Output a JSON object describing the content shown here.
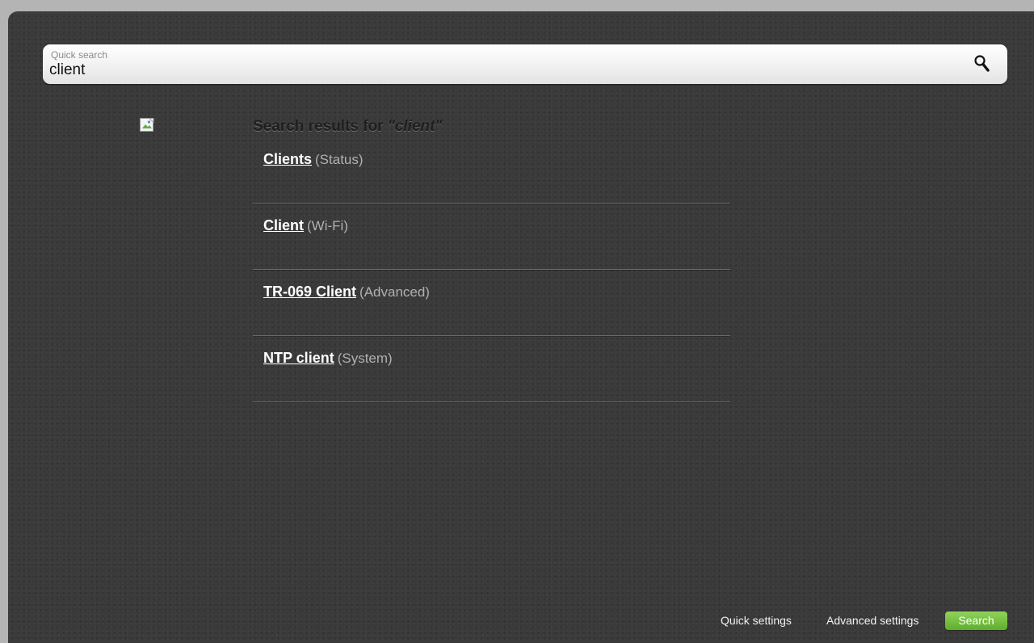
{
  "search": {
    "label": "Quick search",
    "value": "client"
  },
  "results": {
    "title_prefix": "Search results for ",
    "title_query": "\"client\"",
    "items": [
      {
        "label": "Clients",
        "section": "(Status)"
      },
      {
        "label": "Client",
        "section": "(Wi-Fi)"
      },
      {
        "label": "TR-069 Client",
        "section": "(Advanced)"
      },
      {
        "label": "NTP client",
        "section": "(System)"
      }
    ]
  },
  "footer": {
    "quick_settings": "Quick settings",
    "advanced_settings": "Advanced settings",
    "search_button": "Search"
  },
  "colors": {
    "panel_background": "#3a3a3a",
    "accent_green": "#6cbf35"
  },
  "icons": {
    "search": "magnifier-icon",
    "broken_image": "broken-image-icon"
  }
}
